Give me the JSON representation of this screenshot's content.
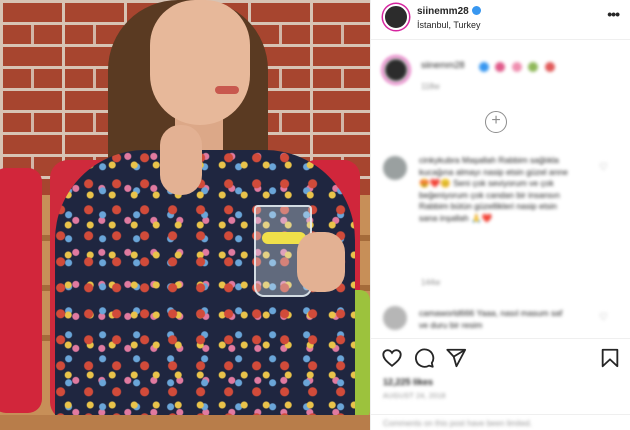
{
  "post": {
    "username": "siinemm28",
    "location": "İstanbul, Turkey",
    "caption": {
      "username": "siinemm28",
      "emoji": [
        {
          "color": "#e05a8a"
        },
        {
          "color": "#ef8fb0"
        },
        {
          "color": "#8fb85a"
        },
        {
          "color": "#e15a5a"
        }
      ],
      "time": "118w"
    },
    "comments": [
      {
        "username": "cinkykubra",
        "text": "cinkykubra Maşallah Rabbim sağlıkla kucağına almayı nasip etsin güzel anne 😍❤️😊 Seni çok seviyorum ve çok beğeniyorum çok candan bir insansın Rabbim bütün güzellikleri nasip etsin sana inşallah 🙏❤️",
        "time": "144w"
      },
      {
        "username": "camaworld666",
        "text": "camaworld666 Yaaa, nasıl masum saf ve duru bir resim"
      }
    ],
    "likes": "12,225 likes",
    "date": "AUGUST 24, 2018",
    "comment_placeholder": "Comments on this post have been limited."
  },
  "icons": {
    "more": "more-options-icon",
    "verified": "verified-badge-icon",
    "like": "heart-icon",
    "comment": "comment-icon",
    "share": "paper-plane-icon",
    "save": "bookmark-icon",
    "load_more": "plus-circle-icon",
    "comment_like": "small-heart-icon"
  },
  "colors": {
    "verified": "#3897f0",
    "story_ring": "#d6249f",
    "muted_text": "#8e8e8e"
  }
}
